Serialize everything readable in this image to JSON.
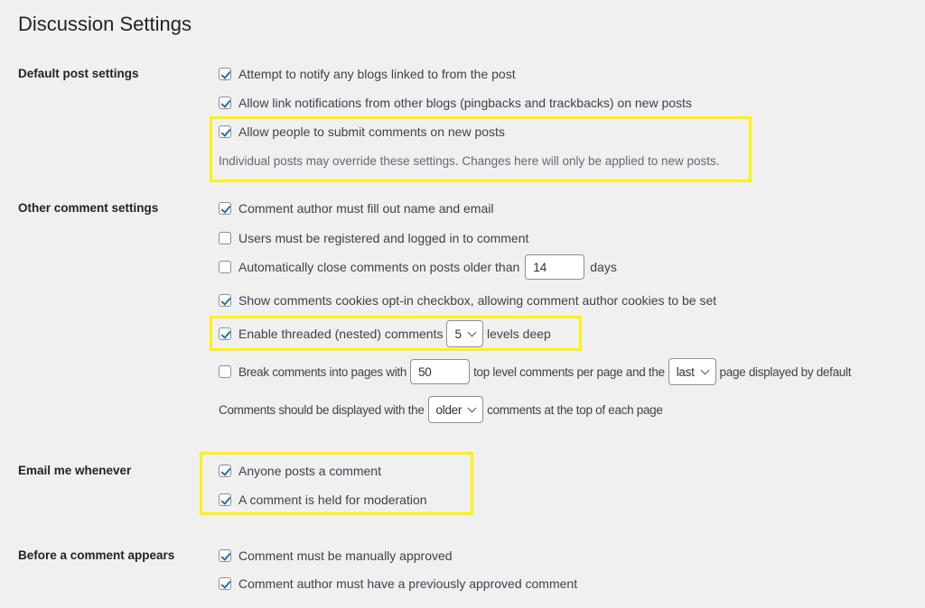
{
  "page": {
    "title": "Discussion Settings"
  },
  "colors": {
    "highlight": "#fff200",
    "checkmark": "#2271b1",
    "background": "#f0f0f1"
  },
  "sections": {
    "default_post": {
      "label": "Default post settings",
      "items": [
        {
          "label": "Attempt to notify any blogs linked to from the post",
          "checked": true
        },
        {
          "label": "Allow link notifications from other blogs (pingbacks and trackbacks) on new posts",
          "checked": true
        },
        {
          "label": "Allow people to submit comments on new posts",
          "checked": true
        }
      ],
      "description": "Individual posts may override these settings. Changes here will only be applied to new posts."
    },
    "other_comment": {
      "label": "Other comment settings",
      "items": [
        {
          "label": "Comment author must fill out name and email",
          "checked": true
        },
        {
          "label": "Users must be registered and logged in to comment",
          "checked": false
        },
        {
          "label": "Automatically close comments on posts older than",
          "checked": false,
          "input_value": "14",
          "suffix": "days"
        },
        {
          "label": "Show comments cookies opt-in checkbox, allowing comment author cookies to be set",
          "checked": true
        },
        {
          "label": "Enable threaded (nested) comments",
          "checked": true,
          "select_value": "5",
          "suffix": "levels deep"
        },
        {
          "label": "Break comments into pages with",
          "checked": false,
          "input_value": "50",
          "middle": "top level comments per page and the",
          "select_value": "last",
          "suffix": "page displayed by default"
        }
      ],
      "order_row": {
        "prefix": "Comments should be displayed with the",
        "select_value": "older",
        "suffix": "comments at the top of each page"
      }
    },
    "email": {
      "label": "Email me whenever",
      "items": [
        {
          "label": "Anyone posts a comment",
          "checked": true
        },
        {
          "label": "A comment is held for moderation",
          "checked": true
        }
      ]
    },
    "before_appears": {
      "label": "Before a comment appears",
      "items": [
        {
          "label": "Comment must be manually approved",
          "checked": true
        },
        {
          "label": "Comment author must have a previously approved comment",
          "checked": true
        }
      ]
    }
  }
}
